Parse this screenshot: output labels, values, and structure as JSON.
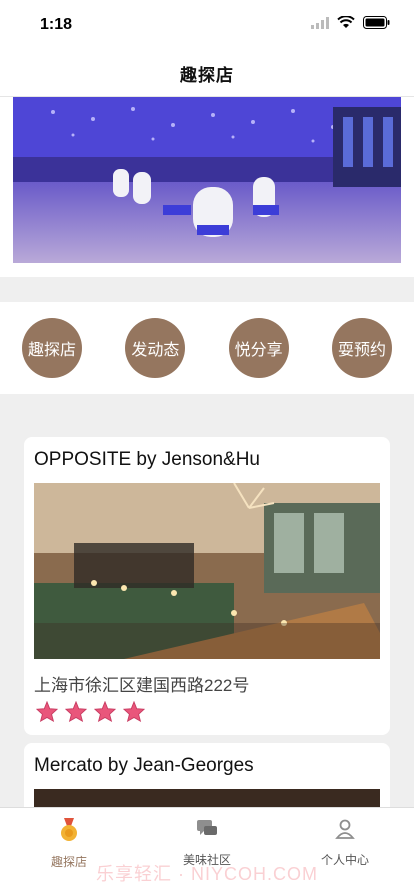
{
  "status_bar": {
    "time": "1:18"
  },
  "nav": {
    "title": "趣探店"
  },
  "menu": [
    {
      "label": "趣探店"
    },
    {
      "label": "发动态"
    },
    {
      "label": "悦分享"
    },
    {
      "label": "耍预约"
    }
  ],
  "restaurants": [
    {
      "name": "OPPOSITE by Jenson&Hu",
      "address": "上海市徐汇区建国西路222号",
      "rating": 4
    },
    {
      "name": "Mercato by Jean-Georges"
    }
  ],
  "tabbar": [
    {
      "label": "趣探店",
      "icon": "medal-icon",
      "active": true
    },
    {
      "label": "美味社区",
      "icon": "chat-icon",
      "active": false
    },
    {
      "label": "个人中心",
      "icon": "user-icon",
      "active": false
    }
  ],
  "watermark": "乐享轻汇 · NIYCOH.COM",
  "colors": {
    "accent": "#95765f",
    "star": "#e9567b"
  }
}
